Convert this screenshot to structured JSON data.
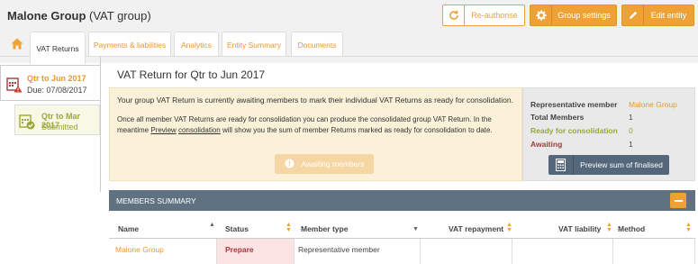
{
  "header": {
    "org_name": "Malone Group",
    "org_type": "(VAT group)",
    "reauthorise_label": "Re-authorise",
    "group_settings_label": "Group settings",
    "edit_entity_label": "Edit entity"
  },
  "tabs": [
    {
      "label": "VAT Returns"
    },
    {
      "label": "Payments & liabilities"
    },
    {
      "label": "Analytics"
    },
    {
      "label": "Entity Summary"
    },
    {
      "label": "Documents"
    }
  ],
  "sidebar": {
    "items": [
      {
        "title": "Qtr to Jun 2017",
        "subtitle": "Due: 07/08/2017"
      },
      {
        "title": "Qtr to Mar 2017",
        "subtitle": "Submitted"
      }
    ]
  },
  "main": {
    "title": "VAT Return for Qtr to Jun 2017",
    "notice_line1": "Your group VAT Return is currently awaiting members to mark their individual VAT Returns as ready for consolidation.",
    "notice_line2_a": "Once all member VAT Returns are ready for consolidation you can produce the consolidated group VAT Return. In the meantime ",
    "notice_link1": "Preview",
    "notice_link2": "consolidation",
    "notice_line2_b": " will show you the sum of member Returns marked as ready for consolidation to date.",
    "awaiting_label": "Awaiting members"
  },
  "summary": {
    "rep_label": "Representative member",
    "rep_value": "Malone Group",
    "total_label": "Total Members",
    "total_value": "1",
    "ready_label": "Ready for consolidation",
    "ready_value": "0",
    "awaiting_label": "Awaiting",
    "awaiting_value": "1",
    "preview_label": "Preview sum of finalised"
  },
  "members": {
    "section_title": "MEMBERS SUMMARY",
    "columns": [
      "Name",
      "Status",
      "Member type",
      "VAT repayment",
      "VAT liability",
      "Method"
    ],
    "rows": [
      {
        "name": "Malone Group",
        "status": "Prepare",
        "member_type": "Representative member",
        "vat_repayment": "",
        "vat_liability": "",
        "method": ""
      }
    ]
  },
  "colors": {
    "accent": "#eea236",
    "link": "#e8972c",
    "danger": "#a33a3a",
    "ready": "#98a83a",
    "bar": "#607282"
  }
}
